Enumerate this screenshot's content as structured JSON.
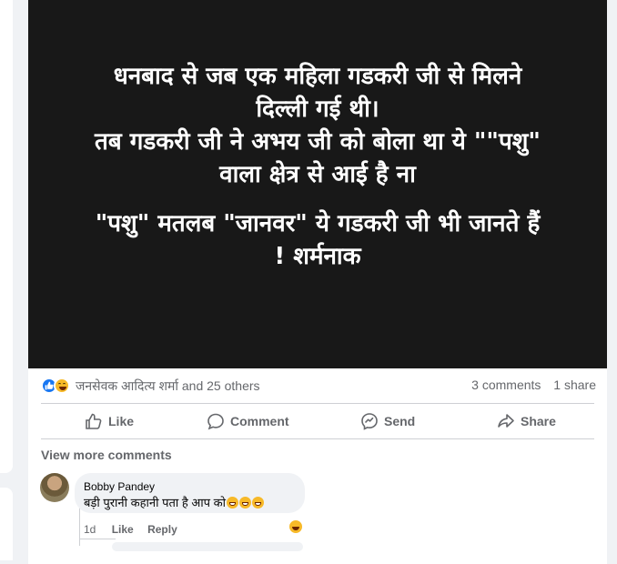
{
  "post": {
    "image_text": {
      "line1": "धनबाद से जब एक महिला गडकरी जी से मिलने",
      "line2": "दिल्ली गई थी।",
      "line3": "तब गडकरी जी ने अभय जी को बोला था ये \"\"पशु\"",
      "line4": "वाला क्षेत्र से आई है ना",
      "line5": "\"पशु\" मतलब \"जानवर\" ये गडकरी जी भी जानते हैं",
      "line6": "! शर्मनाक"
    }
  },
  "reactions": {
    "summary": "जनसेवक आदित्य शर्मा and 25 others",
    "icons": [
      "like-reaction-icon",
      "haha-reaction-icon"
    ],
    "comments_count": "3 comments",
    "shares_count": "1 share"
  },
  "actions": {
    "like": "Like",
    "comment": "Comment",
    "send": "Send",
    "share": "Share"
  },
  "comments": {
    "view_more": "View more comments",
    "items": [
      {
        "author": "Bobby Pandey",
        "text": "बड़ी पुरानी कहानी पता है आप को",
        "emoji": "grin-emoji x3",
        "time": "1d",
        "like_label": "Like",
        "reply_label": "Reply",
        "reaction_icon": "haha-reaction-icon"
      }
    ]
  },
  "colors": {
    "accent": "#1877f2",
    "secondary_text": "#65676b",
    "image_background": "#181818"
  }
}
